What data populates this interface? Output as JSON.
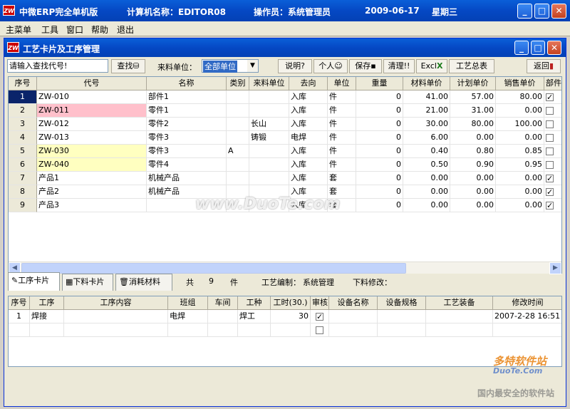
{
  "app": {
    "logo": "ZW",
    "title": "中微ERP完全单机版",
    "computer_label": "计算机名称：EDITOR08",
    "operator_label": "操作员：系统管理员",
    "date": "2009-06-17",
    "weekday": "星期三"
  },
  "menu": [
    "主菜单",
    "工具",
    "窗口",
    "帮助",
    "退出"
  ],
  "child": {
    "title": "工艺卡片及工序管理"
  },
  "toolbar": {
    "search_value": "请输入查找代号!",
    "find_label": "查找",
    "source_label": "来料单位：",
    "source_value": "全部单位",
    "explain": "说明",
    "personal": "个人",
    "save": "保存",
    "clear": "清理!!",
    "excel": "Excl",
    "process_total": "工艺总表",
    "back": "返回"
  },
  "table": {
    "headers": [
      "序号",
      "代号",
      "名称",
      "类别",
      "来料单位",
      "去向",
      "单位",
      "重量",
      "材料单价",
      "计划单价",
      "销售单价",
      "部件"
    ],
    "rows": [
      {
        "no": "1",
        "code": "ZW-010",
        "name": "部件1",
        "cat": "",
        "src": "",
        "dest": "入库",
        "unit": "件",
        "weight": "0",
        "mat": "41.00",
        "plan": "57.00",
        "sale": "80.00",
        "part": true,
        "hl": "sel"
      },
      {
        "no": "2",
        "code": "ZW-011",
        "name": "零件1",
        "cat": "",
        "src": "",
        "dest": "入库",
        "unit": "件",
        "weight": "0",
        "mat": "21.00",
        "plan": "31.00",
        "sale": "0.00",
        "part": false,
        "hl": "pink"
      },
      {
        "no": "3",
        "code": "ZW-012",
        "name": "零件2",
        "cat": "",
        "src": "长山",
        "dest": "入库",
        "unit": "件",
        "weight": "0",
        "mat": "30.00",
        "plan": "80.00",
        "sale": "100.00",
        "part": false,
        "hl": ""
      },
      {
        "no": "4",
        "code": "ZW-013",
        "name": "零件3",
        "cat": "",
        "src": "铸锻",
        "dest": "电焊",
        "unit": "件",
        "weight": "0",
        "mat": "6.00",
        "plan": "0.00",
        "sale": "0.00",
        "part": false,
        "hl": ""
      },
      {
        "no": "5",
        "code": "ZW-030",
        "name": "零件3",
        "cat": "A",
        "src": "",
        "dest": "入库",
        "unit": "件",
        "weight": "0",
        "mat": "0.40",
        "plan": "0.80",
        "sale": "0.85",
        "part": false,
        "hl": "yellow"
      },
      {
        "no": "6",
        "code": "ZW-040",
        "name": "零件4",
        "cat": "",
        "src": "",
        "dest": "入库",
        "unit": "件",
        "weight": "0",
        "mat": "0.50",
        "plan": "0.90",
        "sale": "0.95",
        "part": false,
        "hl": "yellow"
      },
      {
        "no": "7",
        "code": "产品1",
        "name": "机械产品",
        "cat": "",
        "src": "",
        "dest": "入库",
        "unit": "套",
        "weight": "0",
        "mat": "0.00",
        "plan": "0.00",
        "sale": "0.00",
        "part": true,
        "hl": ""
      },
      {
        "no": "8",
        "code": "产品2",
        "name": "机械产品",
        "cat": "",
        "src": "",
        "dest": "入库",
        "unit": "套",
        "weight": "0",
        "mat": "0.00",
        "plan": "0.00",
        "sale": "0.00",
        "part": true,
        "hl": ""
      },
      {
        "no": "9",
        "code": "产品3",
        "name": "",
        "cat": "",
        "src": "",
        "dest": "入库",
        "unit": "套",
        "weight": "0",
        "mat": "0.00",
        "plan": "0.00",
        "sale": "0.00",
        "part": true,
        "hl": ""
      }
    ]
  },
  "tabs": [
    "工序卡片",
    "下料卡片",
    "消耗材料"
  ],
  "summary": {
    "total_label": "共",
    "count": "9",
    "unit": "件",
    "editor_label": "工艺编制：",
    "editor_value": "系统管理",
    "modify_label": "下料修改："
  },
  "ops_table": {
    "headers": [
      "序号",
      "工序",
      "工序内容",
      "班组",
      "车间",
      "工种",
      "工时(30.)",
      "审核",
      "设备名称",
      "设备规格",
      "工艺装备",
      "修改时间"
    ],
    "rows": [
      {
        "no": "1",
        "op": "焊接",
        "content": "",
        "team": "电焊",
        "shop": "",
        "trade": "焊工",
        "hours": "30",
        "audit": true,
        "equip": "",
        "spec": "",
        "tooling": "",
        "time": "2007-2-28 16:51"
      },
      {
        "no": "",
        "op": "",
        "content": "",
        "team": "",
        "shop": "",
        "trade": "",
        "hours": "",
        "audit": false,
        "equip": "",
        "spec": "",
        "tooling": "",
        "time": ""
      }
    ]
  },
  "watermark": {
    "main": "www.DuoTe.com",
    "brand": "多特软件站",
    "brand_url": "DuoTe.Com",
    "slogan": "国内最安全的软件站"
  },
  "colors": {
    "title_blue": "#0548c4",
    "select_blue": "#0a246a",
    "pink": "#ffc0cb",
    "yellow": "#ffffc0"
  }
}
